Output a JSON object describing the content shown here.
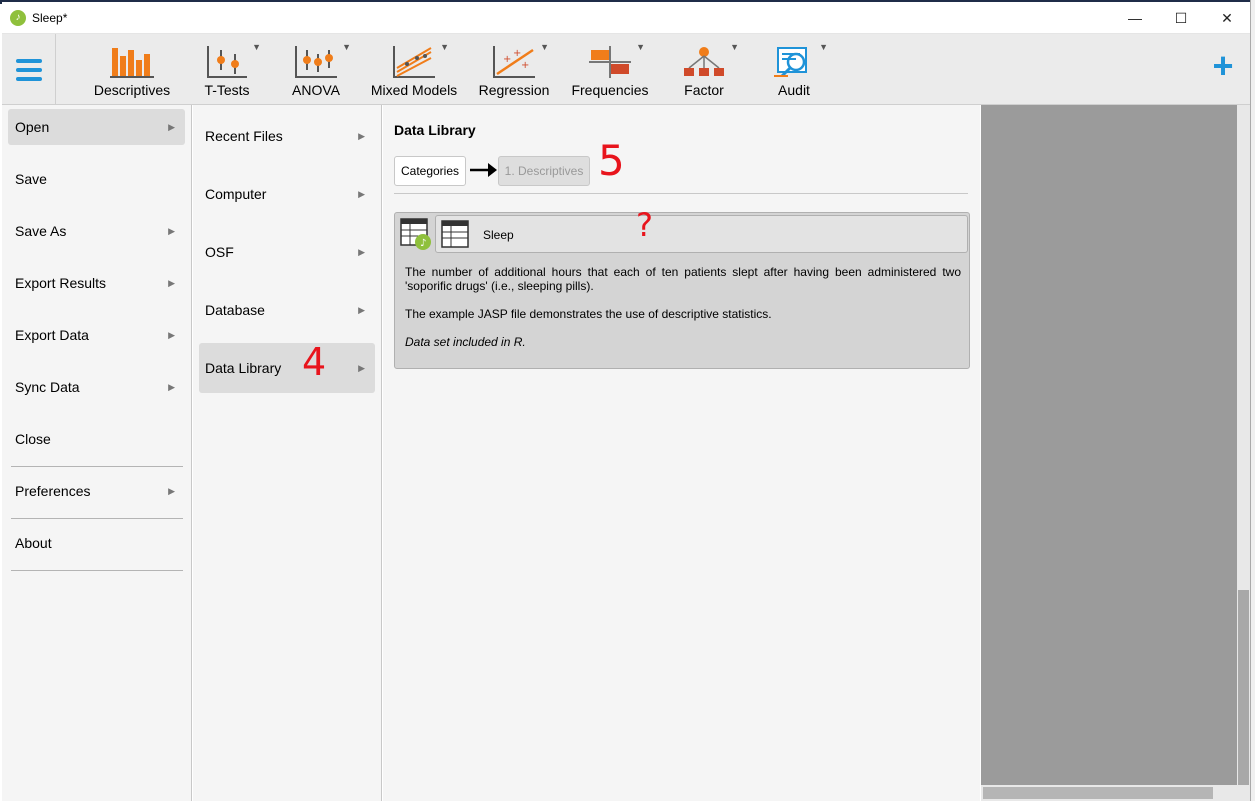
{
  "window": {
    "title": "Sleep*",
    "app_icon": "jasp-leaf-icon",
    "controls": {
      "minimize": "—",
      "maximize": "☐",
      "close": "✕"
    }
  },
  "toolbar": {
    "menu_icon": "hamburger-menu-icon",
    "tools": [
      {
        "label": "Descriptives",
        "icon": "descriptives-bar-chart-icon"
      },
      {
        "label": "T-Tests",
        "icon": "t-tests-icon"
      },
      {
        "label": "ANOVA",
        "icon": "anova-icon"
      },
      {
        "label": "Mixed Models",
        "icon": "mixed-models-icon"
      },
      {
        "label": "Regression",
        "icon": "regression-icon"
      },
      {
        "label": "Frequencies",
        "icon": "frequencies-icon"
      },
      {
        "label": "Factor",
        "icon": "factor-icon"
      },
      {
        "label": "Audit",
        "icon": "audit-icon"
      }
    ],
    "add_symbol": "+",
    "caret": "▼"
  },
  "file_menu": {
    "items": [
      {
        "label": "Open",
        "arrow": "▶"
      },
      {
        "label": "Save",
        "arrow": ""
      },
      {
        "label": "Save As",
        "arrow": "▶"
      },
      {
        "label": "Export Results",
        "arrow": "▶"
      },
      {
        "label": "Export Data",
        "arrow": "▶"
      },
      {
        "label": "Sync Data",
        "arrow": "▶"
      },
      {
        "label": "Close",
        "arrow": ""
      },
      {
        "label": "Preferences",
        "arrow": "▶"
      },
      {
        "label": "About",
        "arrow": ""
      }
    ]
  },
  "open_menu": {
    "items": [
      {
        "label": "Recent Files",
        "arrow": "▶"
      },
      {
        "label": "Computer",
        "arrow": "▶"
      },
      {
        "label": "OSF",
        "arrow": "▶"
      },
      {
        "label": "Database",
        "arrow": "▶"
      },
      {
        "label": "Data Library",
        "arrow": "▶"
      }
    ]
  },
  "data_library": {
    "title": "Data Library",
    "breadcrumb": {
      "root": "Categories",
      "current": "1. Descriptives"
    },
    "card": {
      "name": "Sleep",
      "description_1": "The number of additional hours that each of ten patients slept after having been administered two 'soporific drugs' (i.e., sleeping pills).",
      "description_2": "The example JASP file demonstrates the use of descriptive statistics.",
      "description_3": "Data set included in R."
    }
  },
  "annotations": {
    "a4": "4",
    "a5": "5",
    "q": "?"
  },
  "colors": {
    "accent": "#1f93d8",
    "annotation": "#e8141c",
    "selected": "#dcdcdc"
  }
}
